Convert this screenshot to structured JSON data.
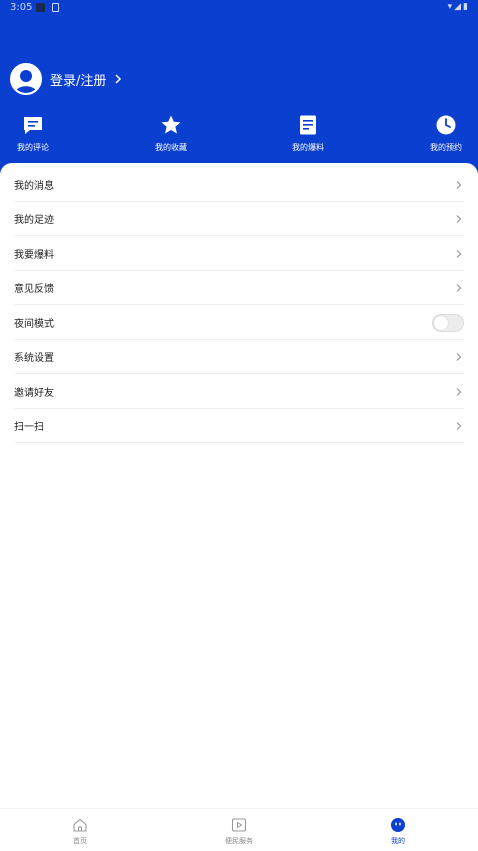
{
  "status_bar": {
    "time": "3:05",
    "icons": [
      "wifi-icon",
      "signal-icon",
      "battery-icon"
    ]
  },
  "profile": {
    "login_label": "登录/注册"
  },
  "shortcuts": [
    {
      "label": "我的评论",
      "icon": "comment-icon"
    },
    {
      "label": "我的收藏",
      "icon": "star-icon"
    },
    {
      "label": "我的爆料",
      "icon": "document-icon"
    },
    {
      "label": "我的预约",
      "icon": "clock-icon"
    }
  ],
  "menu": [
    {
      "label": "我的消息"
    },
    {
      "label": "我的足迹"
    },
    {
      "label": "我要爆料"
    },
    {
      "label": "意见反馈"
    },
    {
      "label": "夜间模式",
      "toggle": false
    },
    {
      "label": "系统设置"
    },
    {
      "label": "邀请好友"
    },
    {
      "label": "扫一扫"
    }
  ],
  "tabbar": [
    {
      "label": "首页",
      "icon": "home-icon",
      "active": false
    },
    {
      "label": "便民服务",
      "icon": "play-box-icon",
      "active": false
    },
    {
      "label": "我的",
      "icon": "profile-face-icon",
      "active": true
    }
  ],
  "colors": {
    "primary": "#0a3fcf",
    "text": "#222222",
    "muted": "#888888"
  }
}
